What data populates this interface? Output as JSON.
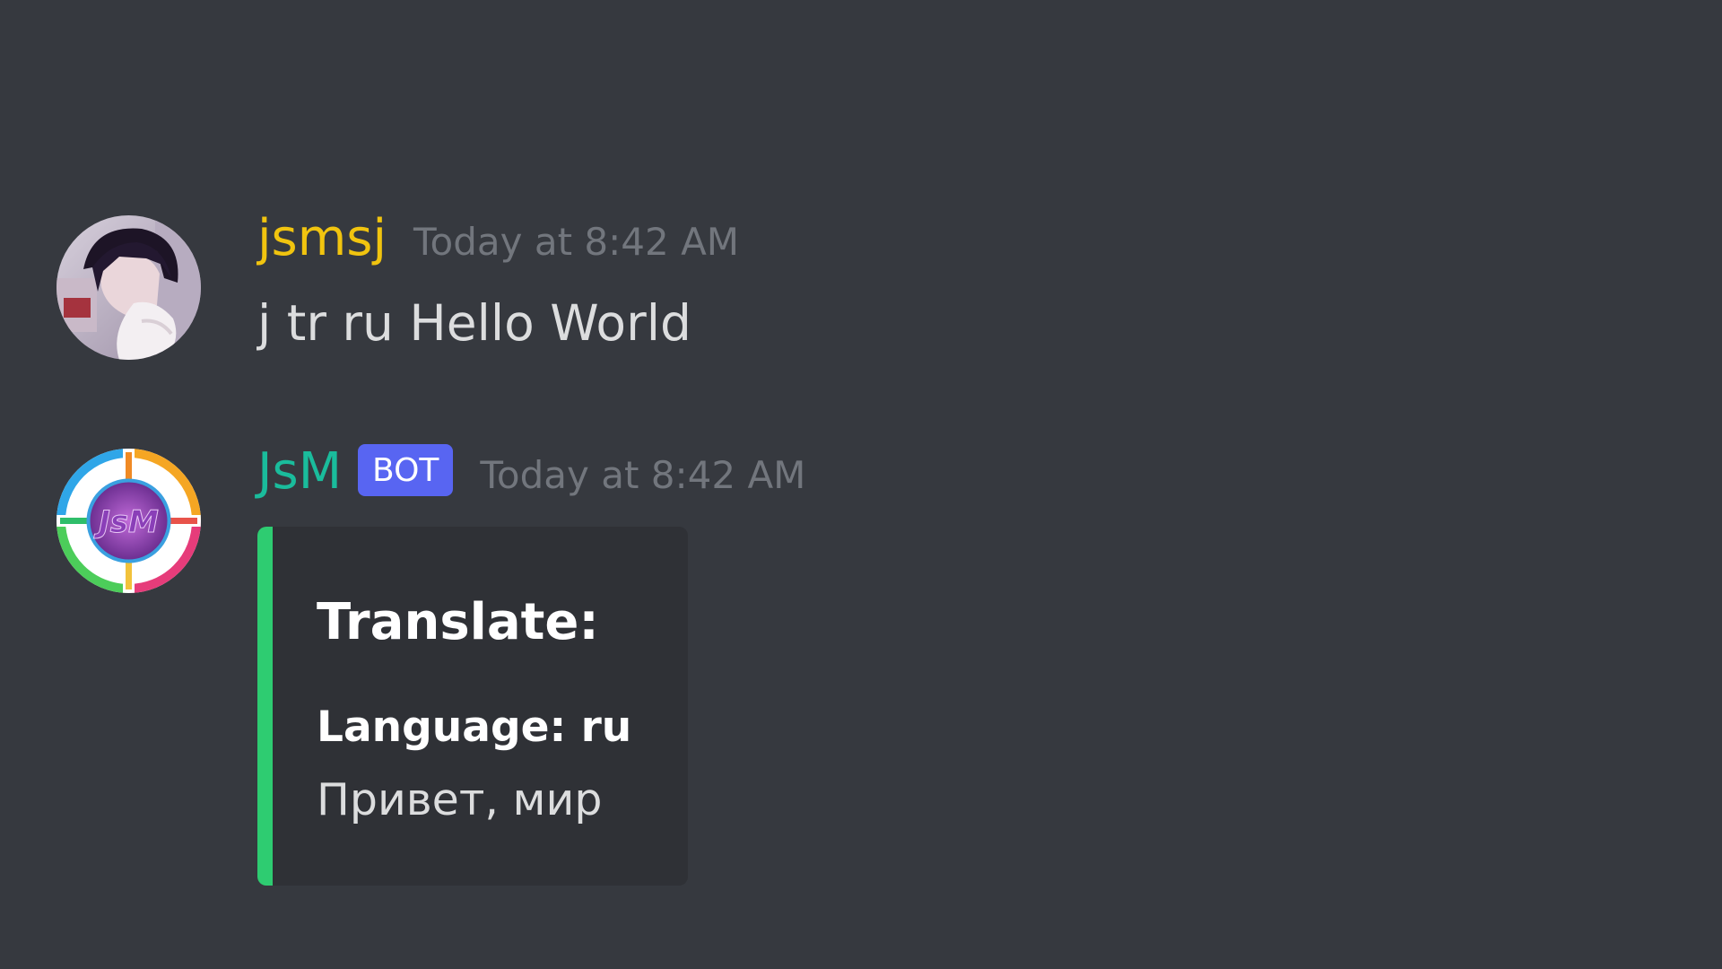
{
  "messages": {
    "user": {
      "username": "jsmsj",
      "timestamp": "Today at 8:42 AM",
      "content": "j tr ru Hello World",
      "avatar_icon": "anime-character-avatar"
    },
    "bot": {
      "username": "JsM",
      "badge": "BOT",
      "timestamp": "Today at 8:42 AM",
      "avatar_icon": "jsm-logo-avatar",
      "avatar_logo_text": "JsM",
      "embed": {
        "title": "Translate:",
        "field_name": "Language: ru",
        "field_value": "Привет, мир",
        "accent_color": "#2ecc71"
      }
    }
  },
  "colors": {
    "background": "#36393f",
    "user_name": "#f1c40f",
    "bot_name": "#1abc9c",
    "bot_badge": "#5865f2",
    "embed_background": "#2f3136"
  }
}
